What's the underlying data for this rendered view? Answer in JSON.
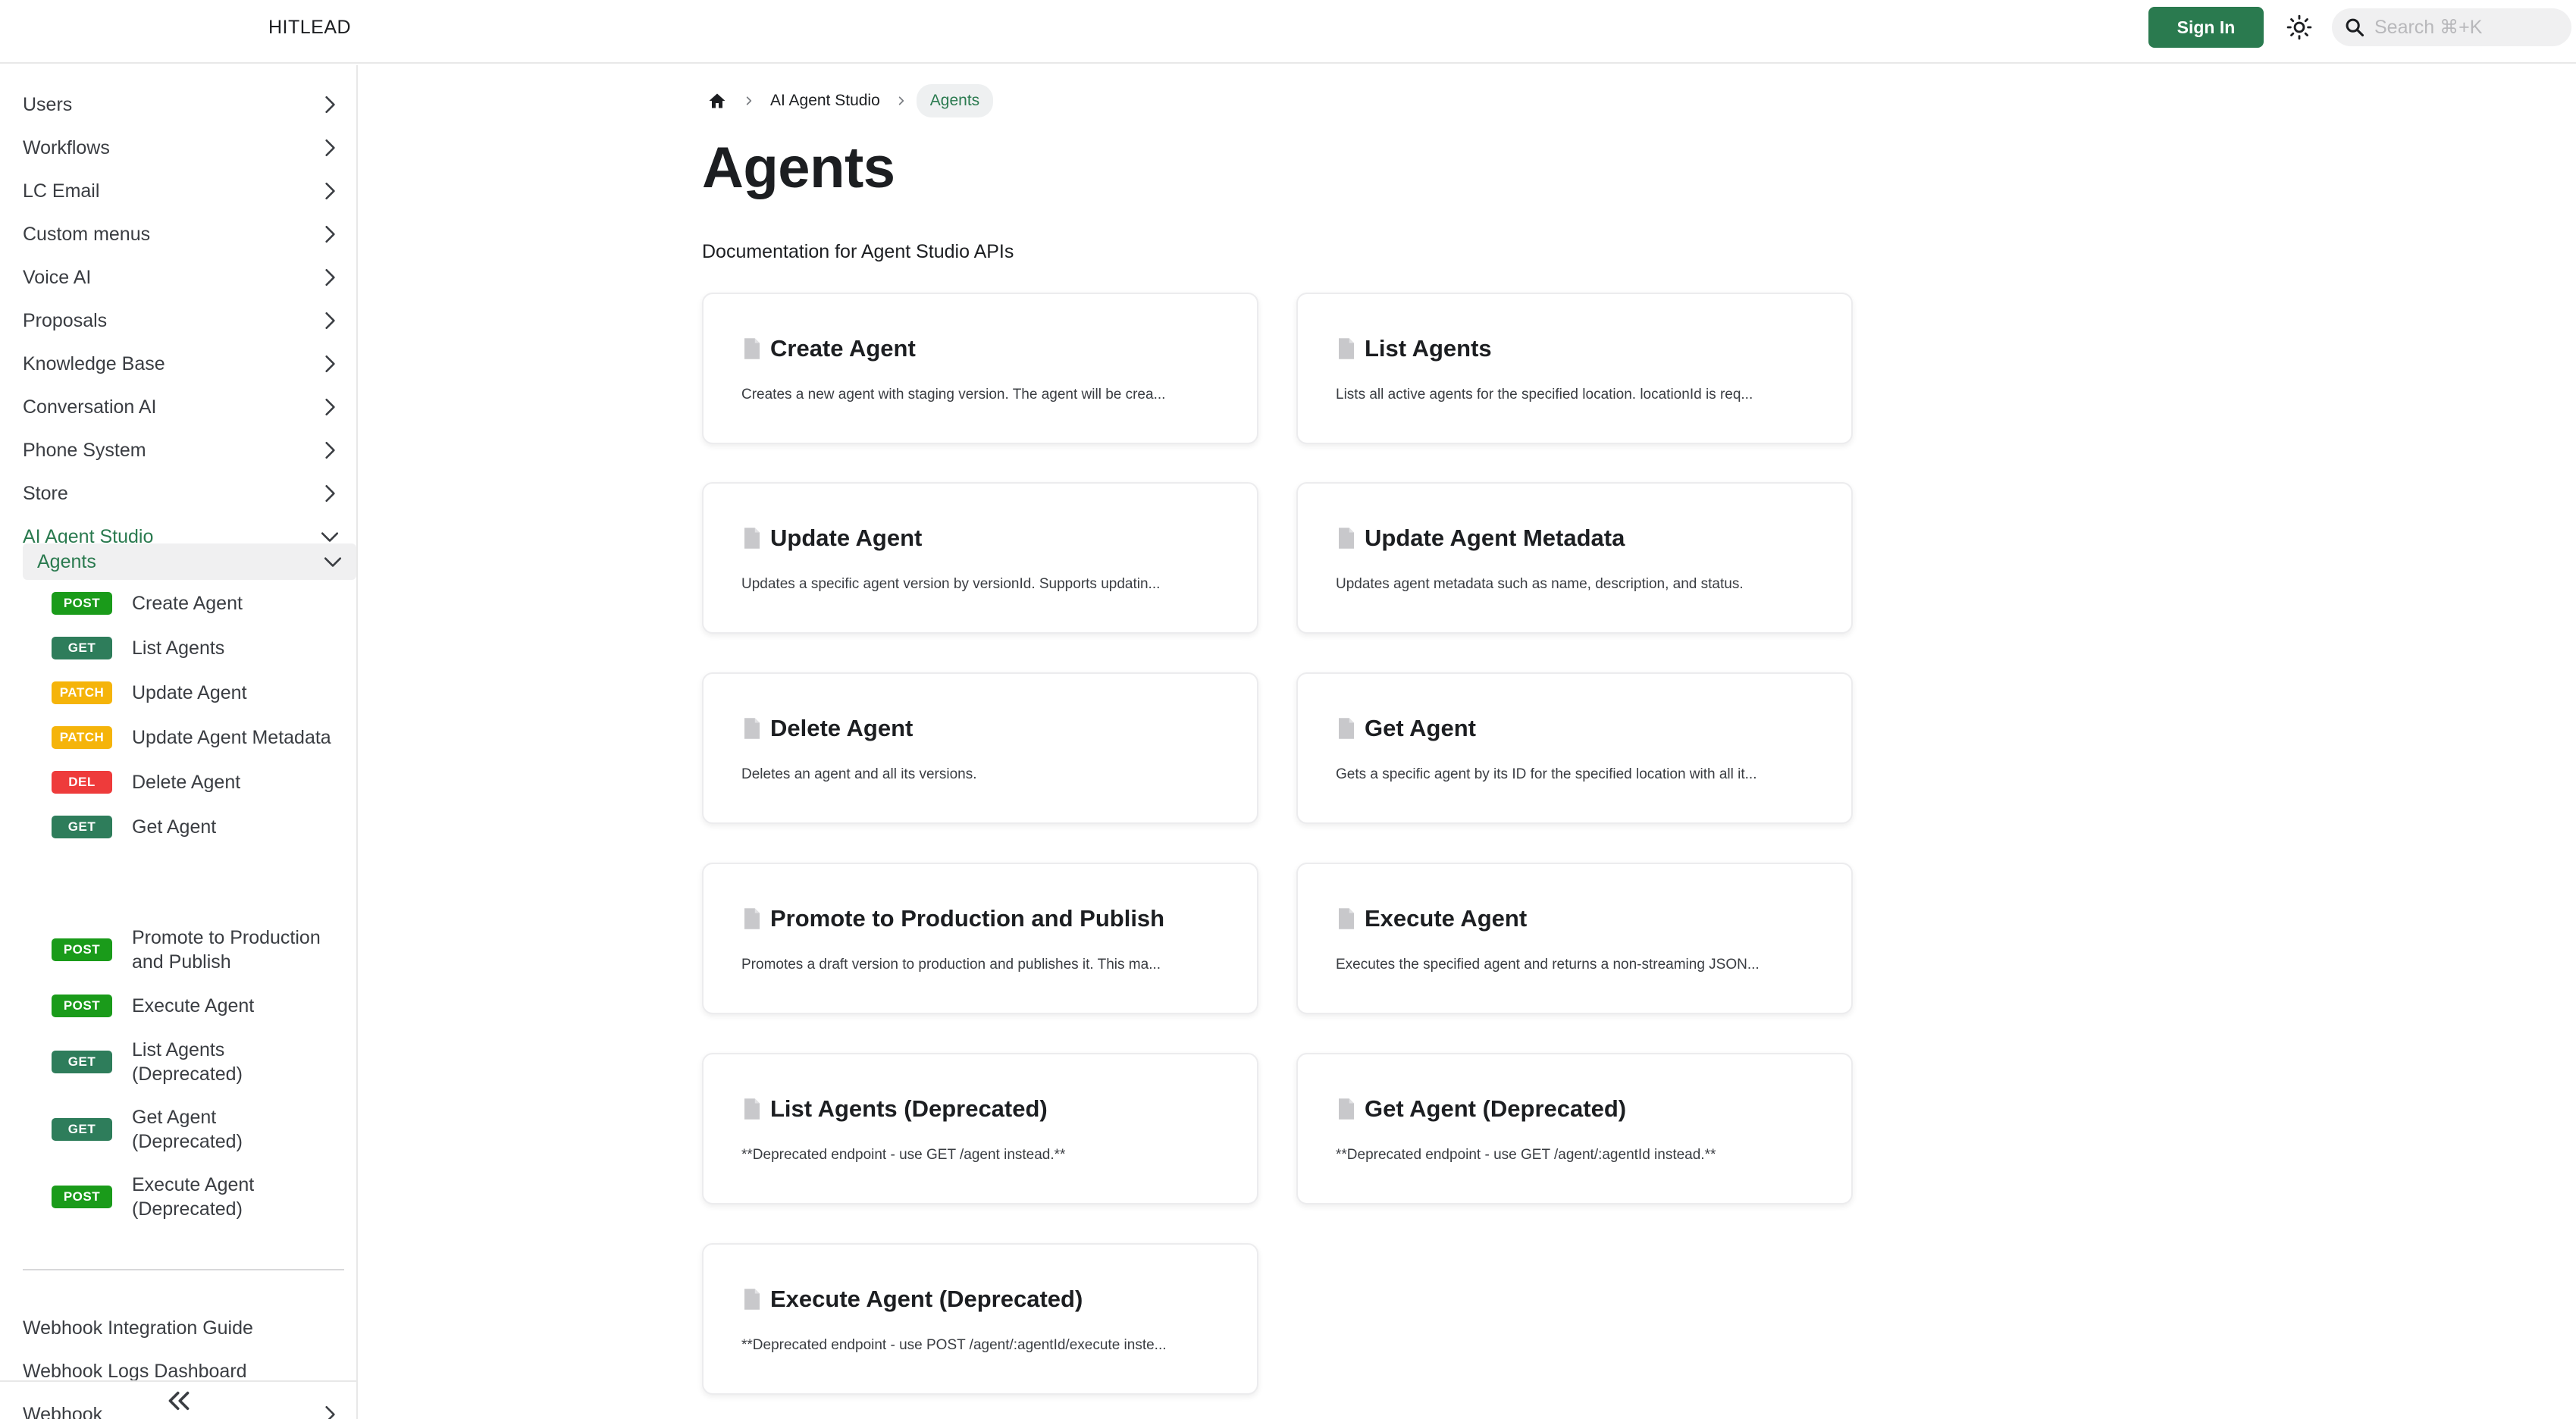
{
  "brand": "HITLEAD",
  "header": {
    "sign_in_label": "Sign In",
    "search_placeholder": "Search ⌘+K"
  },
  "sidebar": {
    "items": [
      {
        "label": "Users"
      },
      {
        "label": "Workflows"
      },
      {
        "label": "LC Email"
      },
      {
        "label": "Custom menus"
      },
      {
        "label": "Voice AI"
      },
      {
        "label": "Proposals"
      },
      {
        "label": "Knowledge Base"
      },
      {
        "label": "Conversation AI"
      },
      {
        "label": "Phone System"
      },
      {
        "label": "Store"
      },
      {
        "label": "AI Agent Studio"
      }
    ],
    "subgroup": {
      "label": "Agents"
    },
    "endpoints": [
      {
        "method": "POST",
        "label": "Create Agent"
      },
      {
        "method": "GET",
        "label": "List Agents"
      },
      {
        "method": "PATCH",
        "label": "Update Agent"
      },
      {
        "method": "PATCH",
        "label": "Update Agent Metadata"
      },
      {
        "method": "DEL",
        "label": "Delete Agent"
      },
      {
        "method": "GET",
        "label": "Get Agent"
      },
      {
        "method": "POST",
        "label": "Promote to Production and Publish"
      },
      {
        "method": "POST",
        "label": "Execute Agent"
      },
      {
        "method": "GET",
        "label": "List Agents (Deprecated)"
      },
      {
        "method": "GET",
        "label": "Get Agent (Deprecated)"
      },
      {
        "method": "POST",
        "label": "Execute Agent (Deprecated)"
      }
    ],
    "footer_items": [
      {
        "label": "Webhook Integration Guide"
      },
      {
        "label": "Webhook Logs Dashboard"
      },
      {
        "label": "Webhook"
      }
    ]
  },
  "breadcrumb": {
    "parent": "AI Agent Studio",
    "current": "Agents"
  },
  "page": {
    "title": "Agents",
    "description": "Documentation for Agent Studio APIs"
  },
  "cards": [
    {
      "title": "Create Agent",
      "description": "Creates a new agent with staging version. The agent will be crea..."
    },
    {
      "title": "List Agents",
      "description": "Lists all active agents for the specified location. locationId is req..."
    },
    {
      "title": "Update Agent",
      "description": "Updates a specific agent version by versionId. Supports updatin..."
    },
    {
      "title": "Update Agent Metadata",
      "description": "Updates agent metadata such as name, description, and status."
    },
    {
      "title": "Delete Agent",
      "description": "Deletes an agent and all its versions."
    },
    {
      "title": "Get Agent",
      "description": "Gets a specific agent by its ID for the specified location with all it..."
    },
    {
      "title": "Promote to Production and Publish",
      "description": "Promotes a draft version to production and publishes it. This ma..."
    },
    {
      "title": "Execute Agent",
      "description": "Executes the specified agent and returns a non-streaming JSON..."
    },
    {
      "title": "List Agents (Deprecated)",
      "description": "**Deprecated endpoint - use GET /agent instead.**"
    },
    {
      "title": "Get Agent (Deprecated)",
      "description": "**Deprecated endpoint - use GET /agent/:agentId instead.**"
    },
    {
      "title": "Execute Agent (Deprecated)",
      "description": "**Deprecated endpoint - use POST /agent/:agentId/execute inste..."
    }
  ],
  "colors": {
    "accent": "#2a7a4f",
    "post": "#1a9b1a",
    "get": "#2e7d5b",
    "patch": "#f5b40a",
    "del": "#ee3b3b"
  }
}
